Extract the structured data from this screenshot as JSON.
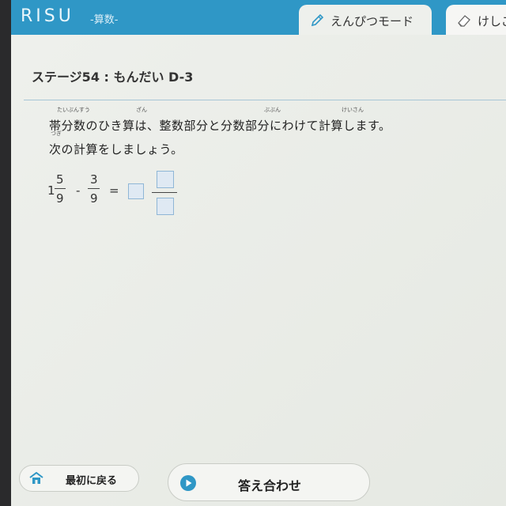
{
  "header": {
    "logo": "RISU",
    "subject": "-算数-",
    "tabs": [
      {
        "label": "えんぴつモード",
        "icon": "pencil-icon",
        "active": true
      },
      {
        "label": "けしご",
        "icon": "eraser-icon",
        "active": false
      }
    ]
  },
  "stage": {
    "title": "ステージ54 : もんだい D-3"
  },
  "instructions": {
    "line1": "帯分数のひき算は、整数部分と分数部分にわけて計算します。",
    "line2": "次の計算をしましょう。",
    "ruby": {
      "obi": "たいぶんすう",
      "zan": "ざん",
      "bubun": "ぶぶん",
      "keisan": "けいさん",
      "tsugi": "つぎ"
    }
  },
  "equation": {
    "whole": "1",
    "num1": "5",
    "den1": "9",
    "minus": "-",
    "num2": "3",
    "den2": "9",
    "equals": "="
  },
  "buttons": {
    "back": "最初に戻る",
    "answer": "答え合わせ"
  },
  "colors": {
    "header": "#2f97c6",
    "input_border": "#8fb6d6",
    "play_icon": "#2f97c6"
  }
}
